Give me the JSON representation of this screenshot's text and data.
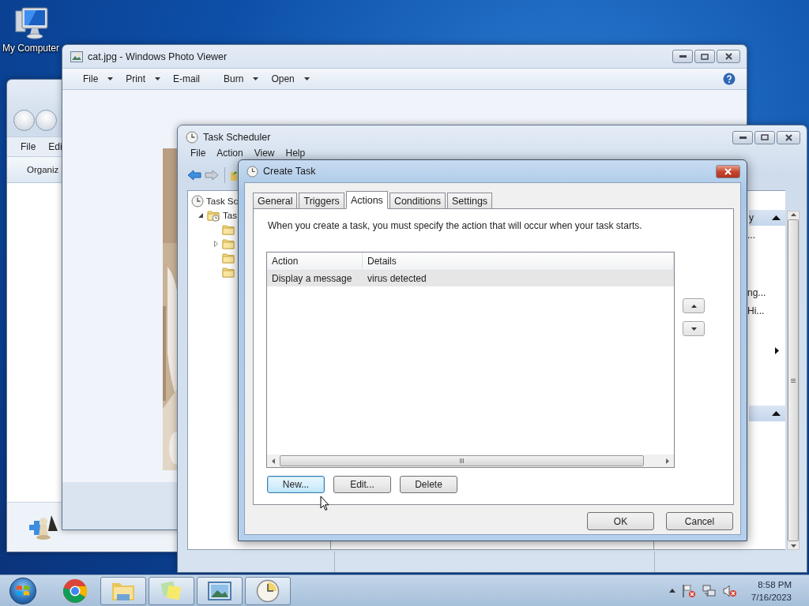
{
  "desktop": {
    "icons": [
      {
        "label": "My Computer"
      }
    ]
  },
  "explorer": {
    "menu": [
      {
        "label": "File"
      },
      {
        "label": "Edi"
      }
    ],
    "toolbar": [
      {
        "label": "Organiz"
      }
    ]
  },
  "photo_viewer": {
    "title": "cat.jpg - Windows Photo Viewer",
    "toolbar": [
      {
        "label": "File",
        "dropdown": true
      },
      {
        "label": "Print",
        "dropdown": true
      },
      {
        "label": "E-mail",
        "dropdown": false
      },
      {
        "label": "Burn",
        "dropdown": true
      },
      {
        "label": "Open",
        "dropdown": true
      }
    ]
  },
  "task_scheduler": {
    "title": "Task Scheduler",
    "menu": [
      {
        "label": "File"
      },
      {
        "label": "Action"
      },
      {
        "label": "View"
      },
      {
        "label": "Help"
      }
    ],
    "tree": [
      {
        "label": "Task Sc",
        "kind": "scheduler",
        "children": [
          {
            "label": "Tas",
            "kind": "library",
            "expanded": true,
            "children": [
              {
                "kind": "folder",
                "expandable": false
              },
              {
                "kind": "folder",
                "expandable": true
              },
              {
                "kind": "folder",
                "expandable": false
              },
              {
                "kind": "folder",
                "expandable": false
              }
            ]
          }
        ]
      }
    ],
    "actions_pane": {
      "sections": [
        {
          "title": "y",
          "expanded": true,
          "items": [
            {
              "kind": "text",
              "label": "..."
            },
            {
              "kind": "text",
              "label": "ng..."
            },
            {
              "kind": "text",
              "label": "Hi..."
            },
            {
              "kind": "submenu"
            }
          ]
        },
        {
          "expanded": true
        }
      ]
    }
  },
  "create_task": {
    "title": "Create Task",
    "tabs": [
      {
        "label": "General",
        "selected": false
      },
      {
        "label": "Triggers",
        "selected": false
      },
      {
        "label": "Actions",
        "selected": true
      },
      {
        "label": "Conditions",
        "selected": false
      },
      {
        "label": "Settings",
        "selected": false
      }
    ],
    "description": "When you create a task, you must specify the action that will occur when your task starts.",
    "table": {
      "columns": [
        "Action",
        "Details"
      ],
      "rows": [
        {
          "cells": [
            "Display a message",
            "virus detected"
          ],
          "selected": true
        }
      ]
    },
    "buttons": [
      {
        "label": "New...",
        "focused": true
      },
      {
        "label": "Edit...",
        "focused": false
      },
      {
        "label": "Delete",
        "focused": false
      }
    ],
    "footer_buttons": [
      {
        "label": "OK"
      },
      {
        "label": "Cancel"
      }
    ]
  },
  "taskbar": {
    "apps": [
      {
        "kind": "chrome",
        "open": false
      },
      {
        "kind": "explorer",
        "open": true
      },
      {
        "kind": "notes",
        "open": true
      },
      {
        "kind": "photos",
        "open": true
      },
      {
        "kind": "scheduler",
        "open": true
      }
    ],
    "clock": {
      "time": "8:58 PM",
      "date": "7/16/2023"
    }
  }
}
